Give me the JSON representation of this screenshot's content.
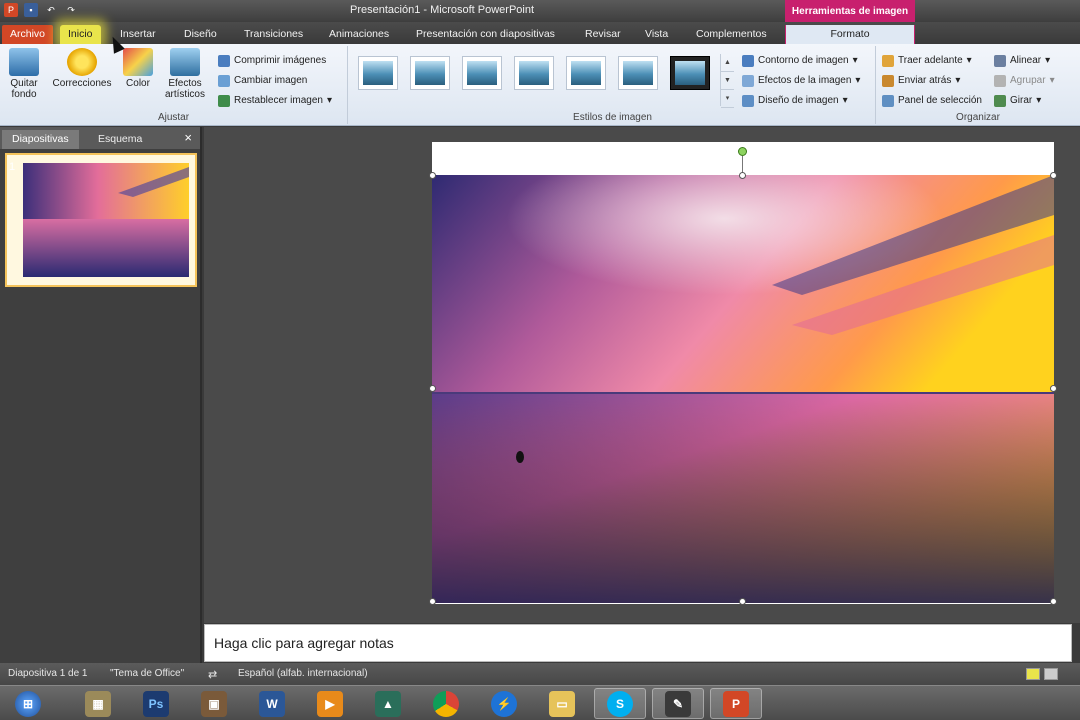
{
  "window": {
    "title": "Presentación1  -  Microsoft PowerPoint",
    "context_tab_header": "Herramientas de imagen"
  },
  "tabs": [
    {
      "label": "Archivo"
    },
    {
      "label": "Inicio"
    },
    {
      "label": "Insertar"
    },
    {
      "label": "Diseño"
    },
    {
      "label": "Transiciones"
    },
    {
      "label": "Animaciones"
    },
    {
      "label": "Presentación con diapositivas"
    },
    {
      "label": "Revisar"
    },
    {
      "label": "Vista"
    },
    {
      "label": "Complementos"
    },
    {
      "label": "Formato"
    }
  ],
  "ribbon": {
    "ajustar": {
      "label": "Ajustar",
      "quitar_fondo": "Quitar fondo",
      "correcciones": "Correcciones",
      "color": "Color",
      "efectos_artisticos": "Efectos artísticos",
      "comprimir": "Comprimir imágenes",
      "cambiar": "Cambiar imagen",
      "restablecer": "Restablecer imagen"
    },
    "estilos": {
      "label": "Estilos de imagen",
      "contorno": "Contorno de imagen",
      "efectos": "Efectos de la imagen",
      "diseno": "Diseño de imagen"
    },
    "organizar": {
      "label": "Organizar",
      "traer": "Traer adelante",
      "enviar": "Enviar atrás",
      "panel": "Panel de selección",
      "alinear": "Alinear",
      "agrupar": "Agrupar",
      "girar": "Girar"
    }
  },
  "left_pane": {
    "tab_slides": "Diapositivas",
    "tab_outline": "Esquema",
    "close": "×",
    "slide_number": "1"
  },
  "notes": {
    "placeholder": "Haga clic para agregar notas"
  },
  "status": {
    "slide_info": "Diapositiva 1 de 1",
    "theme": "\"Tema de Office\"",
    "language": "Español (alfab. internacional)"
  },
  "taskbar": {
    "word": "W",
    "photoshop": "Ps",
    "powerpoint": "P"
  },
  "colors": {
    "file_tab": "#d24726",
    "context_header": "#c8206e",
    "home_highlight": "#e9e44b"
  }
}
